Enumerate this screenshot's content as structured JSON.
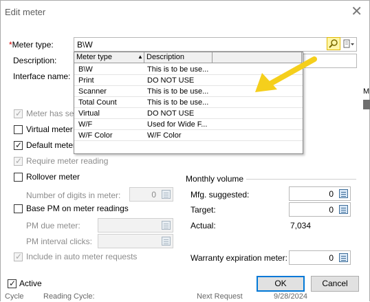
{
  "dialog": {
    "title": "Edit meter",
    "close_glyph": "✕"
  },
  "form": {
    "meter_type_label": "Meter type:",
    "meter_type_value": "B\\W",
    "description_label": "Description:",
    "interface_name_label": "Interface name:",
    "meter_has_seq_label": "Meter has seq",
    "virtual_meter_label": "Virtual meter",
    "default_meter_label": "Default meter",
    "require_meter_reading_label": "Require meter reading",
    "rollover_meter_label": "Rollover meter",
    "digits_label": "Number of digits in meter:",
    "digits_value": "0",
    "base_pm_label": "Base PM on meter readings",
    "pm_due_label": "PM due meter:",
    "pm_interval_label": "PM interval clicks:",
    "auto_meter_label": "Include in auto meter requests",
    "active_label": "Active"
  },
  "monthly": {
    "section_label": "Monthly volume",
    "mfg_label": "Mfg. suggested:",
    "mfg_value": "0",
    "target_label": "Target:",
    "target_value": "0",
    "actual_label": "Actual:",
    "actual_value": "7,034",
    "warranty_label": "Warranty expiration meter:",
    "warranty_value": "0"
  },
  "buttons": {
    "ok": "OK",
    "cancel": "Cancel"
  },
  "dropdown": {
    "columns": [
      "Meter type",
      "Description"
    ],
    "rows": [
      {
        "type": "B\\W",
        "desc": "This is to be use..."
      },
      {
        "type": "Print",
        "desc": "DO NOT USE"
      },
      {
        "type": "Scanner",
        "desc": "This is to be use..."
      },
      {
        "type": "Total Count",
        "desc": "This is to be use..."
      },
      {
        "type": "Virtual",
        "desc": "DO NOT USE"
      },
      {
        "type": "W/F",
        "desc": "Used for Wide F..."
      },
      {
        "type": "W/F Color",
        "desc": "W/F Color"
      }
    ]
  },
  "background": {
    "right_text": "MI",
    "bottom_left": "Cycle",
    "bottom_mid": "Reading Cycle:",
    "bottom_right1": "Next Request",
    "bottom_right2": "9/28/2024"
  },
  "colors": {
    "arrow": "#f5cf1c",
    "accent": "#0078d7",
    "required": "#d40000"
  }
}
